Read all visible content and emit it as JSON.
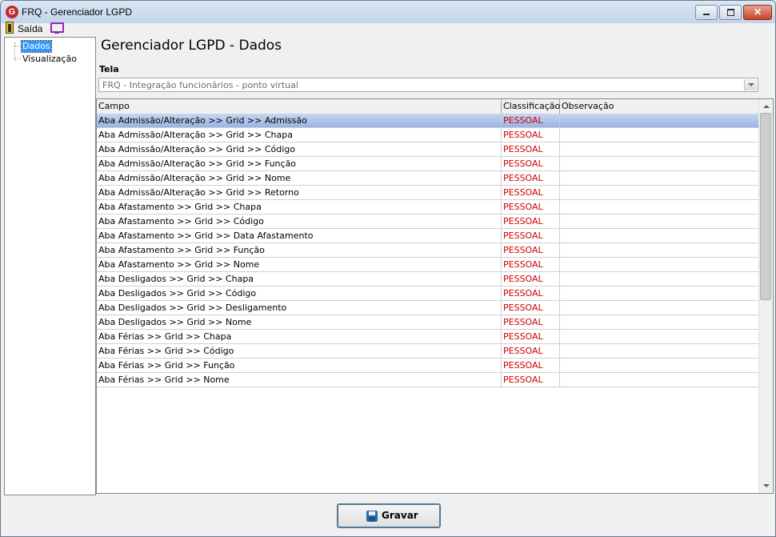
{
  "window": {
    "title": "FRQ - Gerenciador LGPD",
    "app_icon_letter": "G",
    "close_glyph": "✕"
  },
  "menu": {
    "exit_label": "Saída"
  },
  "tree": {
    "items": [
      "Dados",
      "Visualização"
    ],
    "selected": "Dados"
  },
  "page": {
    "title": "Gerenciador LGPD - Dados",
    "tela_label": "Tela",
    "tela_value": "FRQ - Integração funcionários - ponto virtual"
  },
  "grid": {
    "columns": [
      "Campo",
      "Classificação",
      "Observação"
    ],
    "rows": [
      [
        "Aba Admissão/Alteração >> Grid >> Admissão",
        "PESSOAL",
        ""
      ],
      [
        "Aba Admissão/Alteração >> Grid >> Chapa",
        "PESSOAL",
        ""
      ],
      [
        "Aba Admissão/Alteração >> Grid >> Código",
        "PESSOAL",
        ""
      ],
      [
        "Aba Admissão/Alteração >> Grid >> Função",
        "PESSOAL",
        ""
      ],
      [
        "Aba Admissão/Alteração >> Grid >> Nome",
        "PESSOAL",
        ""
      ],
      [
        "Aba Admissão/Alteração >> Grid >> Retorno",
        "PESSOAL",
        ""
      ],
      [
        "Aba Afastamento >> Grid >> Chapa",
        "PESSOAL",
        ""
      ],
      [
        "Aba Afastamento >> Grid >> Código",
        "PESSOAL",
        ""
      ],
      [
        "Aba Afastamento >> Grid >> Data Afastamento",
        "PESSOAL",
        ""
      ],
      [
        "Aba Afastamento >> Grid >> Função",
        "PESSOAL",
        ""
      ],
      [
        "Aba Afastamento >> Grid >> Nome",
        "PESSOAL",
        ""
      ],
      [
        "Aba Desligados >> Grid >> Chapa",
        "PESSOAL",
        ""
      ],
      [
        "Aba Desligados >> Grid >> Código",
        "PESSOAL",
        ""
      ],
      [
        "Aba Desligados >> Grid >> Desligamento",
        "PESSOAL",
        ""
      ],
      [
        "Aba Desligados >> Grid >> Nome",
        "PESSOAL",
        ""
      ],
      [
        "Aba Férias >> Grid >> Chapa",
        "PESSOAL",
        ""
      ],
      [
        "Aba Férias >> Grid >> Código",
        "PESSOAL",
        ""
      ],
      [
        "Aba Férias >> Grid >> Função",
        "PESSOAL",
        ""
      ],
      [
        "Aba Férias >> Grid >> Nome",
        "PESSOAL",
        ""
      ]
    ],
    "selected_row": 0,
    "classification_color": "#cc0000"
  },
  "footer": {
    "save_label": "Gravar"
  }
}
